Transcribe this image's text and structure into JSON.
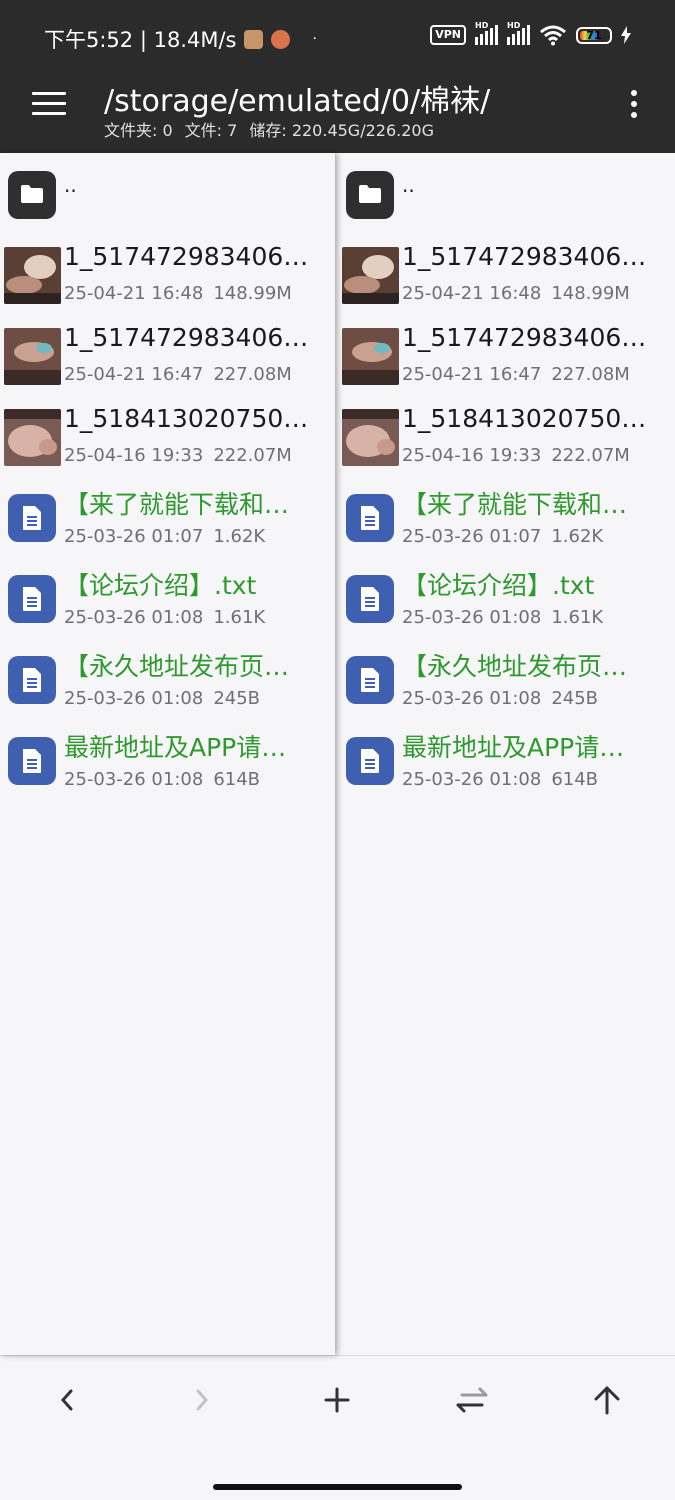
{
  "status_bar": {
    "time_speed": "下午5:52 | 18.4M/s",
    "dot": "·",
    "vpn": "VPN",
    "hd1": "HD",
    "hd2": "HD",
    "battery": "71",
    "app_icon_colors": [
      "#c8956a",
      "#d9734a"
    ]
  },
  "toolbar": {
    "path": "/storage/emulated/0/棉袜/",
    "folders": "文件夹: 0",
    "files": "文件: 7",
    "storage": "储存: 220.45G/226.20G"
  },
  "parent_dir": "..",
  "colors": {
    "toolbar_bg": "#2b2b2b",
    "text_file_green": "#2e9a2e",
    "doc_icon_blue": "#3f5fb0",
    "folder_icon_dark": "#2f2f2f"
  },
  "left_pane": {
    "files": [
      {
        "name": "1_517472983406…",
        "date": "25-04-21 16:48",
        "size": "148.99M",
        "kind": "video",
        "icon": "video-thumbnail"
      },
      {
        "name": "1_517472983406…",
        "date": "25-04-21 16:47",
        "size": "227.08M",
        "kind": "video",
        "icon": "video-thumbnail"
      },
      {
        "name": "1_518413020750…",
        "date": "25-04-16 19:33",
        "size": "222.07M",
        "kind": "video",
        "icon": "video-thumbnail"
      },
      {
        "name": "【来了就能下载和…",
        "date": "25-03-26 01:07",
        "size": "1.62K",
        "kind": "text",
        "icon": "document-icon"
      },
      {
        "name": "【论坛介绍】.txt",
        "date": "25-03-26 01:08",
        "size": "1.61K",
        "kind": "text",
        "icon": "document-icon"
      },
      {
        "name": "【永久地址发布页…",
        "date": "25-03-26 01:08",
        "size": "245B",
        "kind": "text",
        "icon": "document-icon"
      },
      {
        "name": "最新地址及APP请…",
        "date": "25-03-26 01:08",
        "size": "614B",
        "kind": "text",
        "icon": "document-icon"
      }
    ]
  },
  "right_pane": {
    "files": [
      {
        "name": "1_517472983406…",
        "date": "25-04-21 16:48",
        "size": "148.99M",
        "kind": "video",
        "icon": "video-thumbnail"
      },
      {
        "name": "1_517472983406…",
        "date": "25-04-21 16:47",
        "size": "227.08M",
        "kind": "video",
        "icon": "video-thumbnail"
      },
      {
        "name": "1_518413020750…",
        "date": "25-04-16 19:33",
        "size": "222.07M",
        "kind": "video",
        "icon": "video-thumbnail"
      },
      {
        "name": "【来了就能下载和…",
        "date": "25-03-26 01:07",
        "size": "1.62K",
        "kind": "text",
        "icon": "document-icon"
      },
      {
        "name": "【论坛介绍】.txt",
        "date": "25-03-26 01:08",
        "size": "1.61K",
        "kind": "text",
        "icon": "document-icon"
      },
      {
        "name": "【永久地址发布页…",
        "date": "25-03-26 01:08",
        "size": "245B",
        "kind": "text",
        "icon": "document-icon"
      },
      {
        "name": "最新地址及APP请…",
        "date": "25-03-26 01:08",
        "size": "614B",
        "kind": "text",
        "icon": "document-icon"
      }
    ]
  },
  "bottom_bar": {
    "buttons": [
      {
        "name": "back-arrow-icon",
        "enabled": true
      },
      {
        "name": "forward-arrow-icon",
        "enabled": false
      },
      {
        "name": "plus-icon",
        "enabled": true
      },
      {
        "name": "swap-panes-icon",
        "enabled": true
      },
      {
        "name": "up-arrow-icon",
        "enabled": true
      }
    ]
  }
}
